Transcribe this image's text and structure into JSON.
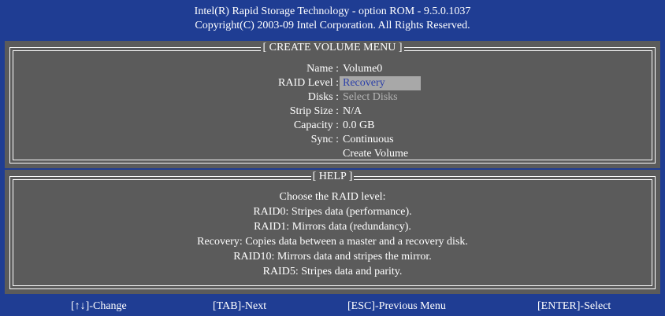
{
  "header": {
    "line1": "Intel(R) Rapid Storage Technology - option ROM - 9.5.0.1037",
    "line2": "Copyright(C) 2003-09 Intel Corporation.  All Rights Reserved."
  },
  "menu": {
    "title": "[ CREATE VOLUME MENU ]",
    "fields": [
      {
        "label": "Name :",
        "value": "Volume0"
      },
      {
        "label": "RAID Level :",
        "value": "Recovery"
      },
      {
        "label": "Disks :",
        "value": "Select Disks"
      },
      {
        "label": "Strip Size :",
        "value": "N/A"
      },
      {
        "label": "Capacity :",
        "value": "0.0 GB"
      },
      {
        "label": "Sync :",
        "value": "Continuous"
      }
    ],
    "create_label": "Create Volume"
  },
  "help": {
    "title": "[ HELP ]",
    "lines": [
      "Choose the RAID level:",
      "RAID0: Stripes data (performance).",
      "RAID1: Mirrors data (redundancy).",
      "Recovery: Copies data between a master and a recovery disk.",
      "RAID10: Mirrors data and stripes the mirror.",
      "RAID5: Stripes data and parity."
    ]
  },
  "footer": {
    "change": "[↑↓]-Change",
    "next": "[TAB]-Next",
    "previous": "[ESC]-Previous Menu",
    "select": "[ENTER]-Select"
  },
  "colors": {
    "background": "#1f3d93",
    "panel": "#5b5b5b",
    "highlight": "#a8a8a8",
    "highlight_text": "#2b3fa8"
  }
}
